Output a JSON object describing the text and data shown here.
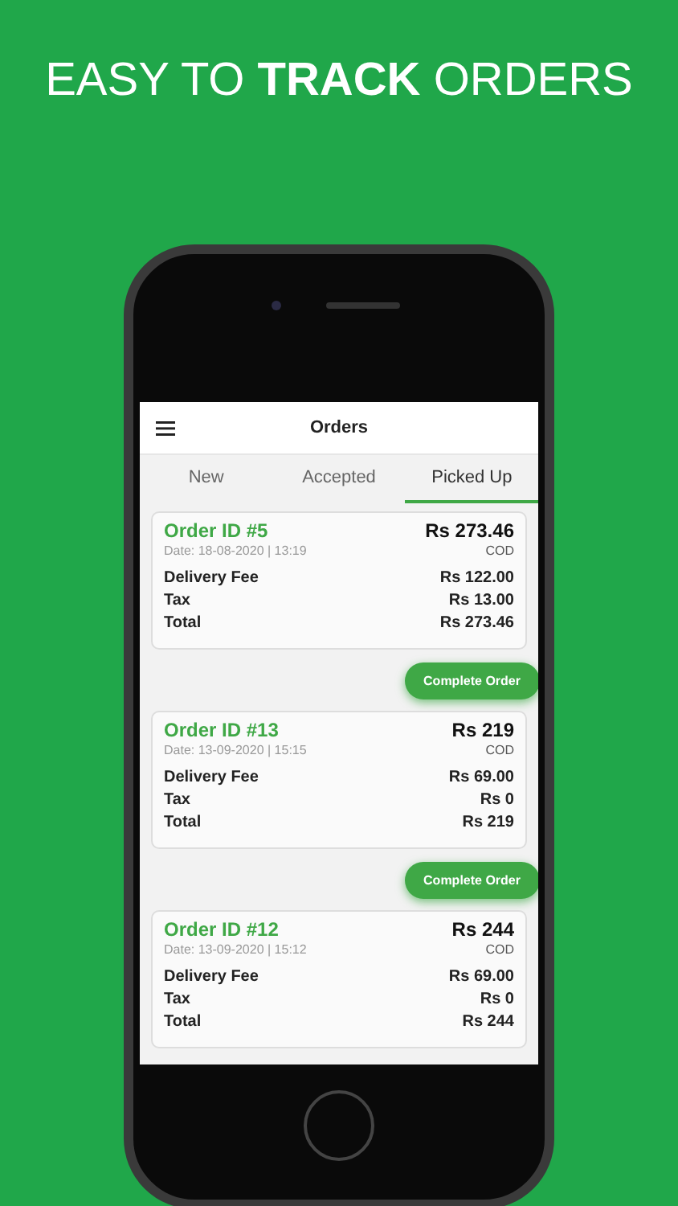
{
  "headline": "EASY TO **TRACK** ORDERS",
  "app_bar": {
    "title": "Orders"
  },
  "tabs": [
    {
      "label": "New",
      "selected": false
    },
    {
      "label": "Accepted",
      "selected": false
    },
    {
      "label": "Picked Up",
      "selected": true
    }
  ],
  "orders": [
    {
      "order_id": "Order ID #5",
      "date": "Date: 18-08-2020 | 13:19",
      "amount": "Rs 273.46",
      "payment": "COD",
      "lines": [
        {
          "label": "Delivery Fee",
          "value": "Rs 122.00"
        },
        {
          "label": "Tax",
          "value": "Rs 13.00"
        },
        {
          "label": "Total",
          "value": "Rs 273.46"
        }
      ],
      "action": "Complete Order"
    },
    {
      "order_id": "Order ID #13",
      "date": "Date: 13-09-2020 | 15:15",
      "amount": "Rs 219",
      "payment": "COD",
      "lines": [
        {
          "label": "Delivery Fee",
          "value": "Rs 69.00"
        },
        {
          "label": "Tax",
          "value": "Rs 0"
        },
        {
          "label": "Total",
          "value": "Rs 219"
        }
      ],
      "action": "Complete Order"
    },
    {
      "order_id": "Order ID #12",
      "date": "Date: 13-09-2020 | 15:12",
      "amount": "Rs 244",
      "payment": "COD",
      "lines": [
        {
          "label": "Delivery Fee",
          "value": "Rs 69.00"
        },
        {
          "label": "Tax",
          "value": "Rs 0"
        },
        {
          "label": "Total",
          "value": "Rs 244"
        }
      ]
    }
  ]
}
